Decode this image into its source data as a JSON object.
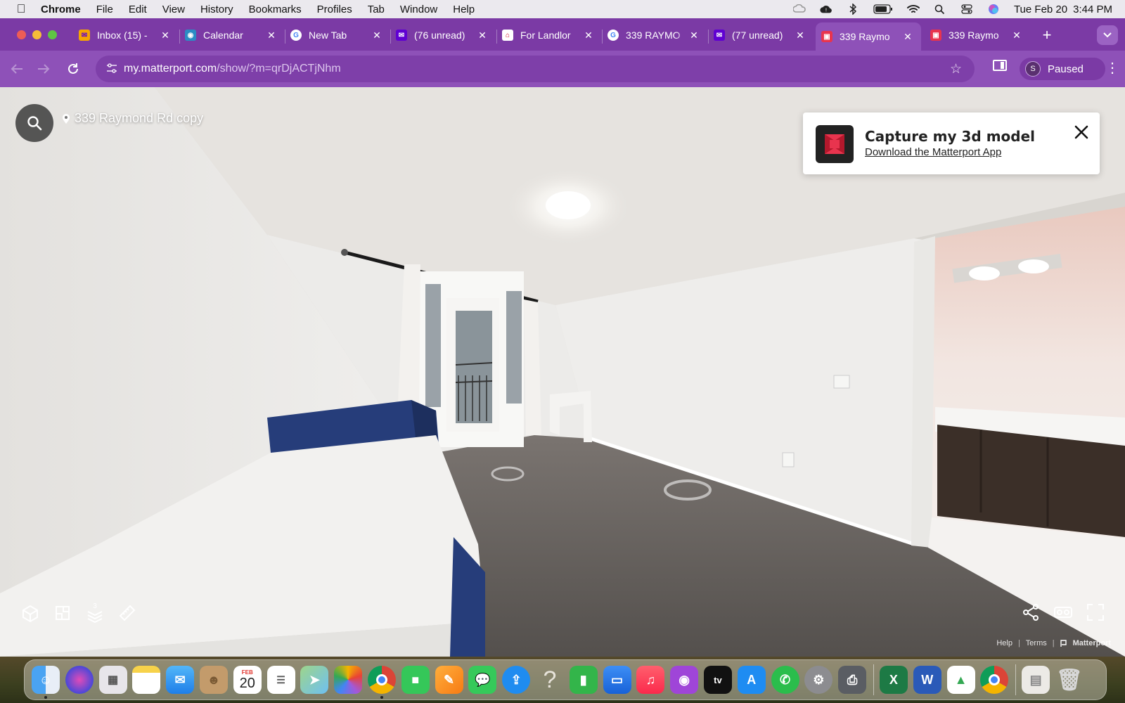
{
  "menubar": {
    "app_name": "Chrome",
    "items": [
      "File",
      "Edit",
      "View",
      "History",
      "Bookmarks",
      "Profiles",
      "Tab",
      "Window",
      "Help"
    ],
    "status_icons": [
      "creative-cloud-icon",
      "icloud-icon",
      "bluetooth-icon",
      "battery-icon",
      "wifi-icon",
      "spotlight-icon",
      "control-center-icon",
      "siri-icon"
    ],
    "date": "Tue Feb 20",
    "time": "3:44 PM"
  },
  "tabs": [
    {
      "title": "Inbox (15) -",
      "favicon": "yahoo-mail-icon",
      "active": false
    },
    {
      "title": "Calendar",
      "favicon": "calendar-owl-icon",
      "active": false
    },
    {
      "title": "New Tab",
      "favicon": "google-icon",
      "active": false
    },
    {
      "title": "(76 unread)",
      "favicon": "yahoo-mail-icon",
      "active": false
    },
    {
      "title": "For Landlor",
      "favicon": "for-landlords-icon",
      "active": false
    },
    {
      "title": "339 RAYMO",
      "favicon": "google-icon",
      "active": false
    },
    {
      "title": "(77 unread)",
      "favicon": "yahoo-mail-icon",
      "active": false
    },
    {
      "title": "339 Raymo",
      "favicon": "matterport-icon",
      "active": true
    },
    {
      "title": "339 Raymo",
      "favicon": "matterport-icon",
      "active": false
    }
  ],
  "toolbar": {
    "url_host": "my.matterport.com",
    "url_path": "/show/?m=qrDjACTjNhm",
    "profile_initial": "S",
    "profile_status": "Paused"
  },
  "viewer": {
    "location_label": "339 Raymond Rd copy",
    "floor_count": "3",
    "promo": {
      "title": "Capture my 3d model",
      "link": "Download the Matterport App"
    },
    "footer": {
      "help": "Help",
      "terms": "Terms",
      "brand": "Matterport"
    }
  },
  "dock": {
    "calendar_month": "FEB",
    "calendar_day": "20",
    "apps": [
      "Finder",
      "Siri",
      "Launchpad",
      "Notes",
      "Mail",
      "Contacts",
      "Calendar",
      "Reminders",
      "Maps",
      "Photos",
      "Chrome",
      "FaceTime",
      "Pages",
      "Messages",
      "iCloud Drive",
      "Help",
      "Numbers",
      "Keynote",
      "Music",
      "Podcasts",
      "Apple TV",
      "App Store",
      "WhatsApp",
      "System Settings",
      "Printer",
      "Excel",
      "Word",
      "Google Drive",
      "Chrome (Profile)",
      "Documents",
      "Trash"
    ]
  },
  "colors": {
    "chrome_tabstrip": "#7b3aa5",
    "chrome_toolbar": "#8e51b8",
    "matterport_red": "#e8344e"
  }
}
